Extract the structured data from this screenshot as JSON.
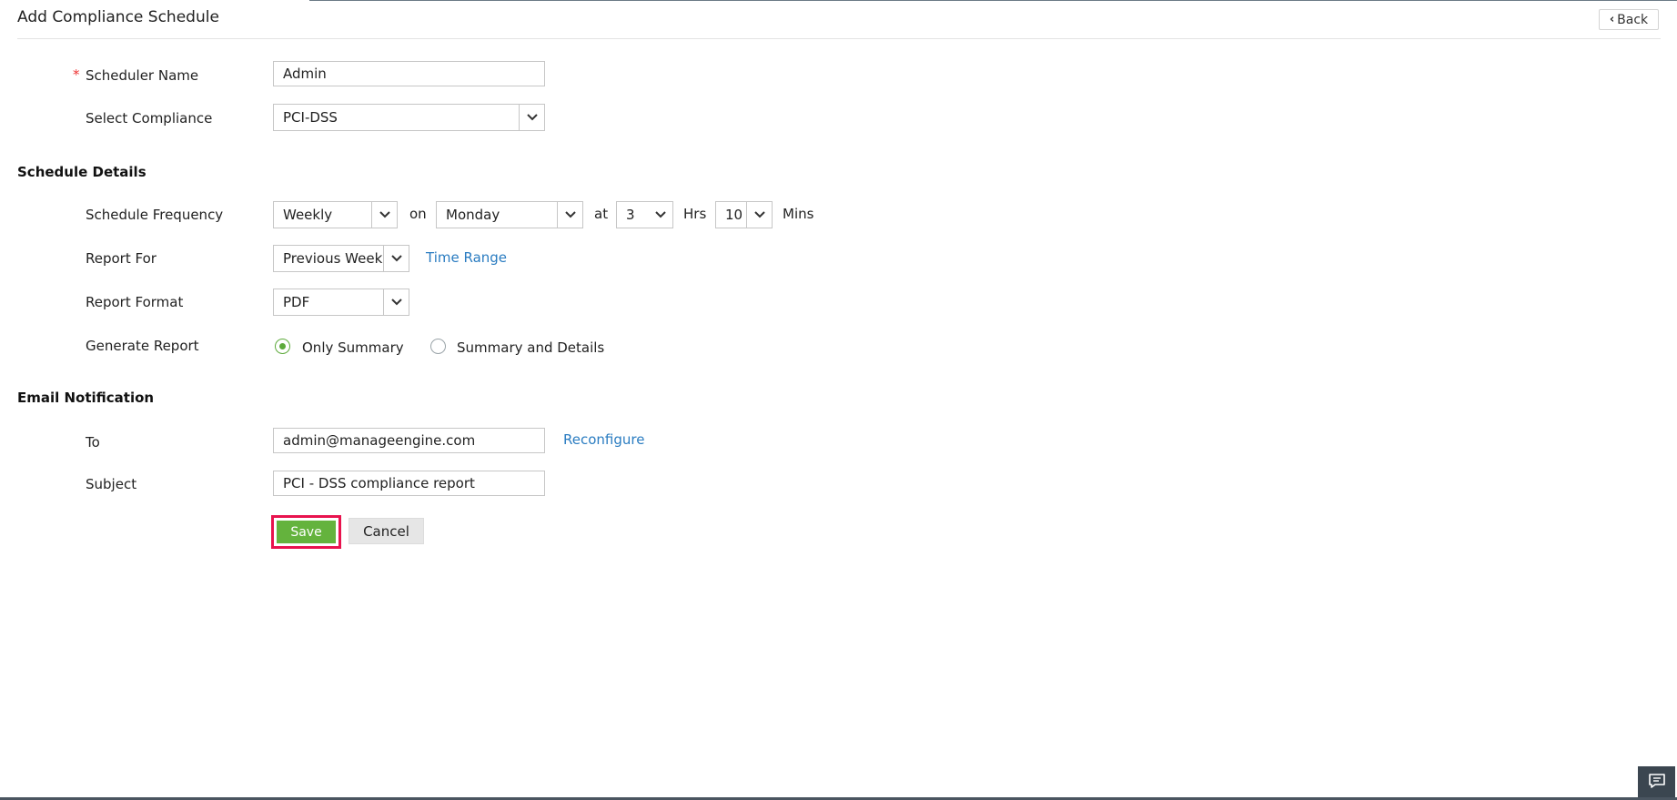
{
  "header": {
    "title": "Add Compliance Schedule",
    "back_label": "Back"
  },
  "form": {
    "required_marker": "*",
    "scheduler_name": {
      "label": "Scheduler Name",
      "value": "Admin"
    },
    "select_compliance": {
      "label": "Select Compliance",
      "value": "PCI-DSS"
    }
  },
  "schedule_details": {
    "heading": "Schedule Details",
    "frequency": {
      "label": "Schedule Frequency",
      "value": "Weekly",
      "on_text": "on",
      "day_value": "Monday",
      "at_text": "at",
      "hour_value": "3",
      "hrs_text": "Hrs",
      "minute_value": "10",
      "mins_text": "Mins"
    },
    "report_for": {
      "label": "Report For",
      "value": "Previous Week",
      "time_range_link": "Time Range"
    },
    "report_format": {
      "label": "Report Format",
      "value": "PDF"
    },
    "generate_report": {
      "label": "Generate Report",
      "options": [
        {
          "label": "Only Summary",
          "selected": true
        },
        {
          "label": "Summary and Details",
          "selected": false
        }
      ]
    }
  },
  "email_notification": {
    "heading": "Email Notification",
    "to": {
      "label": "To",
      "value": "admin@manageengine.com",
      "reconfigure_link": "Reconfigure"
    },
    "subject": {
      "label": "Subject",
      "value": "PCI - DSS compliance report"
    }
  },
  "actions": {
    "save_label": "Save",
    "cancel_label": "Cancel"
  },
  "colors": {
    "accent_green": "#64b33d",
    "link_blue": "#2a7cc1",
    "highlight_pink": "#e8134e"
  },
  "icons": {
    "back": "chevron-left-icon",
    "dropdown": "chevron-down-icon",
    "chat": "chat-icon"
  }
}
